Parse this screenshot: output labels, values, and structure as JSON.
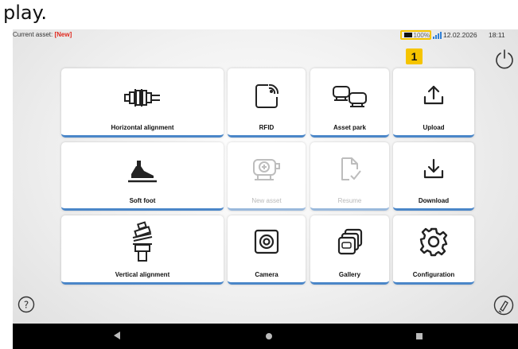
{
  "top_text": "play.",
  "status": {
    "asset_label": "Current asset: ",
    "asset_value": "[New]",
    "battery_percent": "100%",
    "date": "12.02.2026",
    "time": "18:11",
    "highlight_color": "#f5c400",
    "asset_value_color": "#e0281e"
  },
  "callout": {
    "number": "1"
  },
  "tiles": {
    "horizontal_alignment": "Horizontal alignment",
    "rfid": "RFID",
    "asset_park": "Asset park",
    "upload": "Upload",
    "soft_foot": "Soft foot",
    "new_asset": "New asset",
    "resume": "Resume",
    "download": "Download",
    "vertical_alignment": "Vertical alignment",
    "camera": "Camera",
    "gallery": "Gallery",
    "configuration": "Configuration"
  },
  "icons": [
    "power-icon",
    "help-icon",
    "flashlight-icon",
    "back-icon",
    "home-icon",
    "recent-apps-icon"
  ],
  "tile_accent_color": "#4a86c8"
}
